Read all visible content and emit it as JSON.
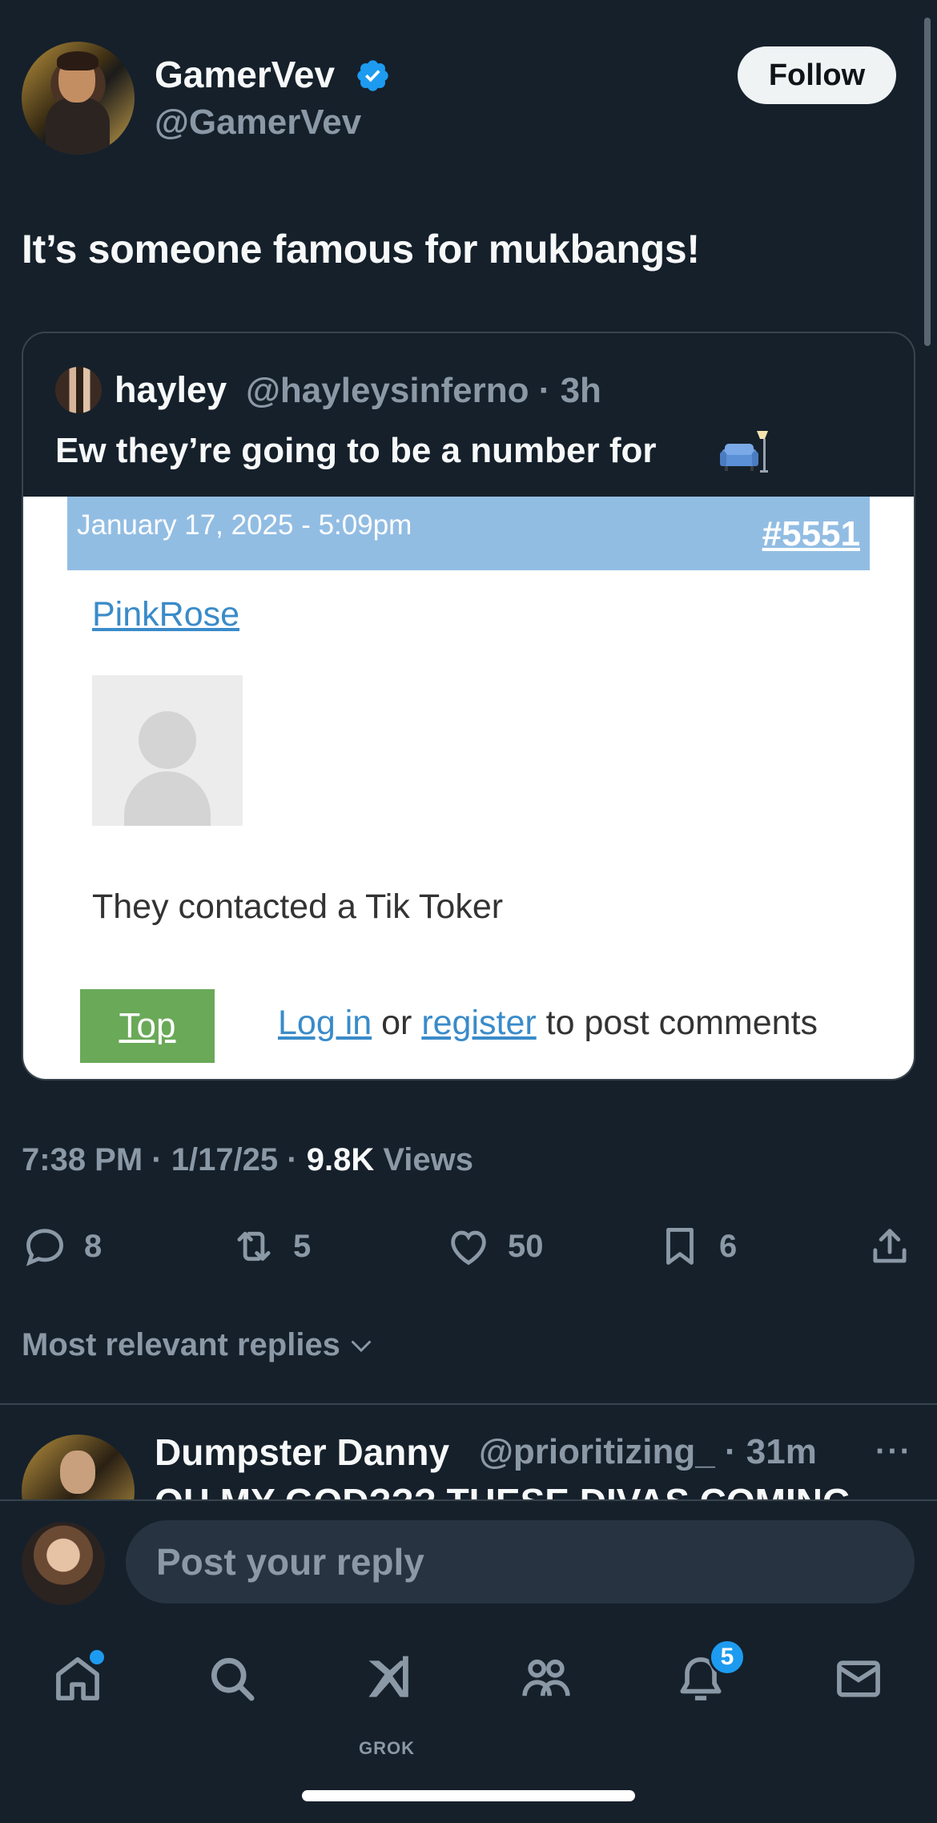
{
  "tweet": {
    "author": {
      "name": "GamerVev",
      "handle": "@GamerVev",
      "verified": true
    },
    "follow_label": "Follow",
    "text": "It’s someone famous for mukbangs!",
    "quote": {
      "name": "hayley",
      "handle": "@hayleysinferno · 3h",
      "text": "Ew they’re going to be a number for",
      "emoji_icon": "couch-and-lamp",
      "media": {
        "date": "January 17, 2025 - 5:09pm",
        "post_number": "#5551",
        "username": "PinkRose",
        "comment": "They contacted a Tik Toker",
        "top_label": "Top",
        "login_label": "Log in",
        "or_text": " or ",
        "register_label": "register",
        "suffix_text": " to post comments"
      }
    },
    "meta": {
      "time": "7:38 PM · 1/17/25 · ",
      "views_count": "9.8K",
      "views_label": " Views"
    },
    "actions": {
      "replies": "8",
      "retweets": "5",
      "likes": "50",
      "bookmarks": "6"
    }
  },
  "replies_filter": "Most relevant replies",
  "first_reply": {
    "name": "Dumpster Danny",
    "handle": "@prioritizing_ · 31m",
    "more": "···",
    "text": "OH MY GOD??? THESE DIVAS COMING"
  },
  "composer": {
    "placeholder": "Post your reply"
  },
  "nav": {
    "grok_label": "GROK",
    "notifications_count": "5"
  },
  "colors": {
    "background": "#15202b",
    "accent": "#1d9bf0",
    "muted": "#8b98a5",
    "forum_bar": "#92bde3",
    "top_button": "#6aa958"
  }
}
